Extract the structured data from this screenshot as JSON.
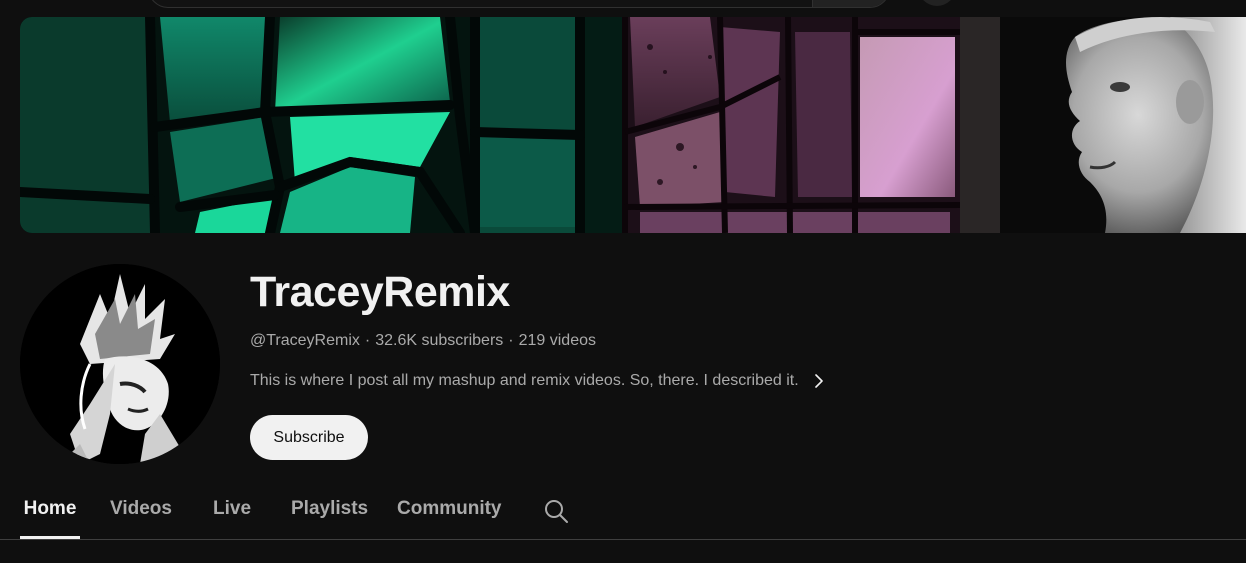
{
  "channel": {
    "name": "TraceyRemix",
    "handle": "@TraceyRemix",
    "subscribers": "32.6K subscribers",
    "videos": "219 videos",
    "separator": "·",
    "description": "This is where I post all my mashup and remix videos. So, there. I described it."
  },
  "actions": {
    "subscribe_label": "Subscribe"
  },
  "tabs": [
    {
      "label": "Home",
      "active": true
    },
    {
      "label": "Videos",
      "active": false
    },
    {
      "label": "Live",
      "active": false
    },
    {
      "label": "Playlists",
      "active": false
    },
    {
      "label": "Community",
      "active": false
    }
  ],
  "icons": {
    "tab_search": "search-icon",
    "description_more": "chevron-right-icon"
  },
  "colors": {
    "background": "#0f0f0f",
    "text_primary": "#f1f1f1",
    "text_secondary": "#aaaaaa",
    "subscribe_bg": "#f1f1f1",
    "subscribe_text": "#0f0f0f",
    "divider": "#3f3f3f"
  }
}
